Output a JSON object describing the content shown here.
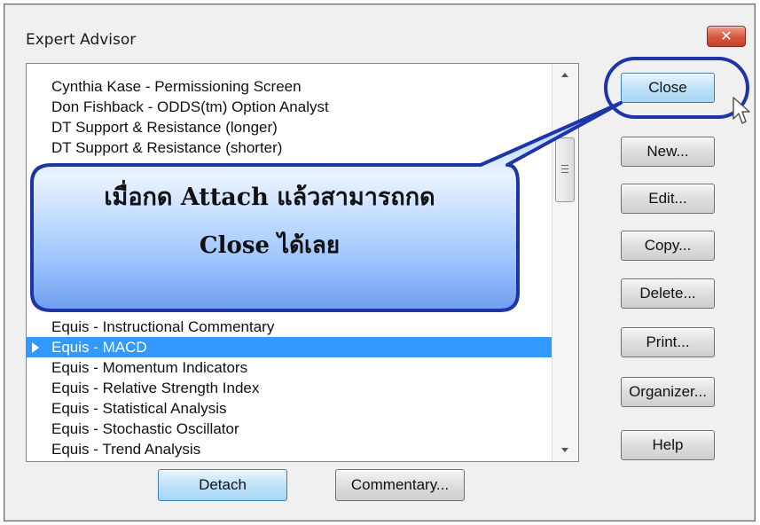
{
  "window": {
    "title": "Expert Advisor",
    "close_glyph": "✕"
  },
  "list": {
    "items": [
      {
        "label": "Cynthia Kase - Permissioning Screen",
        "selected": false
      },
      {
        "label": "Don Fishback - ODDS(tm) Option Analyst",
        "selected": false
      },
      {
        "label": "DT Support & Resistance (longer)",
        "selected": false
      },
      {
        "label": "DT Support & Resistance (shorter)",
        "selected": false
      },
      {
        "label": "Equis - Instructional Commentary",
        "selected": false
      },
      {
        "label": "Equis - MACD",
        "selected": true
      },
      {
        "label": "Equis - Momentum Indicators",
        "selected": false
      },
      {
        "label": "Equis - Relative Strength Index",
        "selected": false
      },
      {
        "label": "Equis - Statistical Analysis",
        "selected": false
      },
      {
        "label": "Equis - Stochastic Oscillator",
        "selected": false
      },
      {
        "label": "Equis - Trend Analysis",
        "selected": false
      }
    ],
    "selected_color": "#3399ff"
  },
  "buttons": {
    "close": "Close",
    "new": "New...",
    "edit": "Edit...",
    "copy": "Copy...",
    "delete": "Delete...",
    "print": "Print...",
    "organizer": "Organizer...",
    "help": "Help",
    "detach": "Detach",
    "commentary": "Commentary..."
  },
  "callout": {
    "line1": "เมื่อกด Attach แล้วสามารถกด",
    "line2": "Close ได้เลย",
    "fill_color": "#8ab8ff",
    "border_color": "#1e35a8"
  },
  "icons": {
    "cursor": "mouse-pointer-icon",
    "selection_marker": "triangle-right-icon"
  }
}
